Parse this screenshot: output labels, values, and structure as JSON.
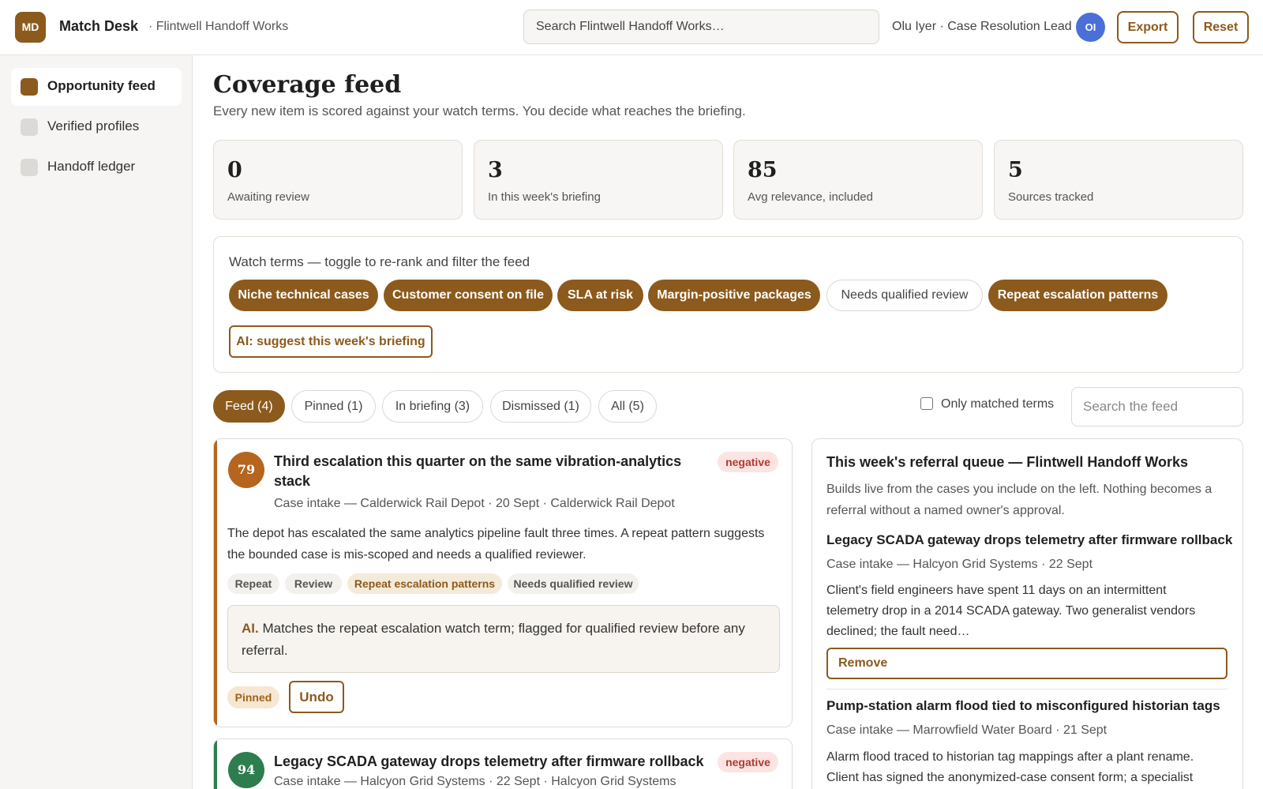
{
  "header": {
    "logo_text": "MD",
    "app_name": "Match Desk",
    "org_name": "· Flintwell Handoff Works",
    "search_placeholder": "Search Flintwell Handoff Works…",
    "user_label": "Olu Iyer · Case Resolution Lead",
    "avatar_initials": "OI",
    "export_label": "Export",
    "reset_label": "Reset"
  },
  "sidebar": {
    "items": [
      {
        "label": "Opportunity feed",
        "active": true
      },
      {
        "label": "Verified profiles",
        "active": false
      },
      {
        "label": "Handoff ledger",
        "active": false
      }
    ]
  },
  "page": {
    "title": "Coverage feed",
    "subtitle": "Every new item is scored against your watch terms. You decide what reaches the briefing."
  },
  "stats": [
    {
      "value": "0",
      "label": "Awaiting review"
    },
    {
      "value": "3",
      "label": "In this week's briefing"
    },
    {
      "value": "85",
      "label": "Avg relevance, included"
    },
    {
      "value": "5",
      "label": "Sources tracked"
    }
  ],
  "watch_terms": {
    "title": "Watch terms — toggle to re-rank and filter the feed",
    "terms": [
      {
        "label": "Niche technical cases",
        "on": true
      },
      {
        "label": "Customer consent on file",
        "on": true
      },
      {
        "label": "SLA at risk",
        "on": true
      },
      {
        "label": "Margin-positive packages",
        "on": true
      },
      {
        "label": "Needs qualified review",
        "on": false
      },
      {
        "label": "Repeat escalation patterns",
        "on": true
      }
    ],
    "ai_button": "AI: suggest this week's briefing"
  },
  "tabs": [
    {
      "label": "Feed (4)",
      "active": true
    },
    {
      "label": "Pinned (1)",
      "active": false
    },
    {
      "label": "In briefing (3)",
      "active": false
    },
    {
      "label": "Dismissed (1)",
      "active": false
    },
    {
      "label": "All (5)",
      "active": false
    }
  ],
  "filters": {
    "only_matched_label": "Only matched terms",
    "feed_search_placeholder": "Search the feed"
  },
  "cards": [
    {
      "score": "79",
      "title": "Third escalation this quarter on the same vibration-analytics stack",
      "sentiment": "negative",
      "meta": "Case intake — Calderwick Rail Depot · 20 Sept · Calderwick Rail Depot",
      "body": "The depot has escalated the same analytics pipeline fault three times. A repeat pattern suggests the bounded case is mis-scoped and needs a qualified reviewer.",
      "tags": [
        "Repeat",
        "Review",
        "Repeat escalation patterns",
        "Needs qualified review"
      ],
      "ai_prefix": "AI.",
      "ai_note": "Matches the repeat escalation watch term; flagged for qualified review before any referral.",
      "status": "Pinned",
      "action": "Undo"
    },
    {
      "score": "94",
      "title": "Legacy SCADA gateway drops telemetry after firmware rollback",
      "sentiment": "negative",
      "meta": "Case intake — Halcyon Grid Systems · 22 Sept · Halcyon Grid Systems"
    }
  ],
  "queue": {
    "title": "This week's referral queue — Flintwell Handoff Works",
    "subtitle": "Builds live from the cases you include on the left. Nothing becomes a referral without a named owner's approval.",
    "items": [
      {
        "title": "Legacy SCADA gateway drops telemetry after firmware rollback",
        "meta": "Case intake — Halcyon Grid Systems · 22 Sept",
        "body": "Client's field engineers have spent 11 days on an intermittent telemetry drop in a 2014 SCADA gateway. Two generalist vendors declined; the fault need…",
        "action": "Remove"
      },
      {
        "title": "Pump-station alarm flood tied to misconfigured historian tags",
        "meta": "Case intake — Marrowfield Water Board · 21 Sept",
        "body": "Alarm flood traced to historian tag mappings after a plant rename. Client has signed the anonymized-case consent form; a specialist"
      }
    ]
  },
  "colors": {
    "accent": "#8c5a1c",
    "score_orange": "#b5651d",
    "score_green": "#2e7d4f",
    "negative_bg": "#fbe4e2",
    "negative_text": "#b23a2f",
    "avatar_blue": "#4a6fd8"
  }
}
